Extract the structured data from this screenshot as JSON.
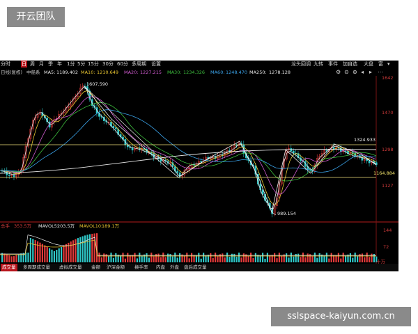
{
  "watermarks": {
    "top": "开云团队",
    "bottom": "sslspace-kaiyun.com.cn"
  },
  "toolbar": {
    "periods": [
      "分时",
      "日",
      "周",
      "月",
      "季",
      "年",
      "1分",
      "5分",
      "15分",
      "30分",
      "60分",
      "多周期",
      "设置"
    ],
    "active_period": "日",
    "right_items": [
      "龙头回调",
      "九转",
      "事件",
      "加自选",
      "大盘",
      "富"
    ]
  },
  "ma_bar": {
    "prefix": "日线(复权)",
    "name": "中船系",
    "items": [
      {
        "label": "MA5:",
        "value": "1189.402",
        "color": "#e6e6e6"
      },
      {
        "label": "MA10:",
        "value": "1210.649",
        "color": "#e8c531"
      },
      {
        "label": "MA20:",
        "value": "1227.215",
        "color": "#d15bd1"
      },
      {
        "label": "MA30:",
        "value": "1234.326",
        "color": "#3dbd3d"
      },
      {
        "label": "MA60:",
        "value": "1248.470",
        "color": "#3aa2e8"
      },
      {
        "label": "MA250:",
        "value": "1278.128",
        "color": "#e6e6e6"
      }
    ]
  },
  "price_axis": {
    "labels": [
      "1642",
      "1470",
      "1298",
      "1127"
    ]
  },
  "annotations": {
    "high": "1607.590",
    "low": "989.154",
    "resistance": "1324.933",
    "support": "1164.884"
  },
  "volume_bar": {
    "label": "总手",
    "value": "353.5万",
    "mavol5_label": "MAVOL5:",
    "mavol5": "203.5万",
    "mavol10_label": "MAVOL10:",
    "mavol10": "189.1万",
    "axis": [
      "144",
      "72",
      "十万"
    ]
  },
  "bottom_tabs": [
    "成交量",
    "多周期成交量",
    "虚拟成交量",
    "金额",
    "沪深金额",
    "换手率",
    "内盘",
    "外盘",
    "盘后成交量"
  ],
  "active_tab": "成交量",
  "colors": {
    "up": "#e23a3a",
    "down": "#2fc8c8",
    "background": "#000000",
    "accent_red": "#b8141c"
  }
}
